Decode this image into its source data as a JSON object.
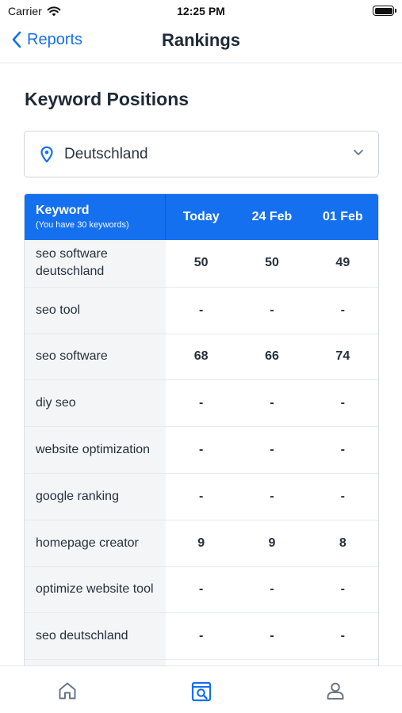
{
  "status": {
    "carrier": "Carrier",
    "time": "12:25 PM"
  },
  "nav": {
    "back_label": "Reports",
    "title": "Rankings"
  },
  "section": {
    "title": "Keyword Positions"
  },
  "country": {
    "selected": "Deutschland"
  },
  "table": {
    "header": {
      "keyword": "Keyword",
      "subtitle": "(You have 30 keywords)",
      "columns": [
        "Today",
        "24 Feb",
        "01 Feb"
      ]
    },
    "rows": [
      {
        "keyword": "seo software deutschland",
        "values": [
          "50",
          "50",
          "49"
        ]
      },
      {
        "keyword": "seo tool",
        "values": [
          "-",
          "-",
          "-"
        ]
      },
      {
        "keyword": "seo software",
        "values": [
          "68",
          "66",
          "74"
        ]
      },
      {
        "keyword": "diy seo",
        "values": [
          "-",
          "-",
          "-"
        ]
      },
      {
        "keyword": "website optimization",
        "values": [
          "-",
          "-",
          "-"
        ]
      },
      {
        "keyword": "google ranking",
        "values": [
          "-",
          "-",
          "-"
        ]
      },
      {
        "keyword": "homepage creator",
        "values": [
          "9",
          "9",
          "8"
        ]
      },
      {
        "keyword": "optimize website tool",
        "values": [
          "-",
          "-",
          "-"
        ]
      },
      {
        "keyword": "seo deutschland",
        "values": [
          "-",
          "-",
          "-"
        ]
      },
      {
        "keyword": "",
        "values": [
          "",
          "",
          ""
        ]
      }
    ]
  },
  "tabs": [
    {
      "icon": "home-icon",
      "active": false
    },
    {
      "icon": "search-report-icon",
      "active": true
    },
    {
      "icon": "profile-icon",
      "active": false
    }
  ],
  "colors": {
    "accent": "#1570ef",
    "inactive": "#6b7684"
  }
}
